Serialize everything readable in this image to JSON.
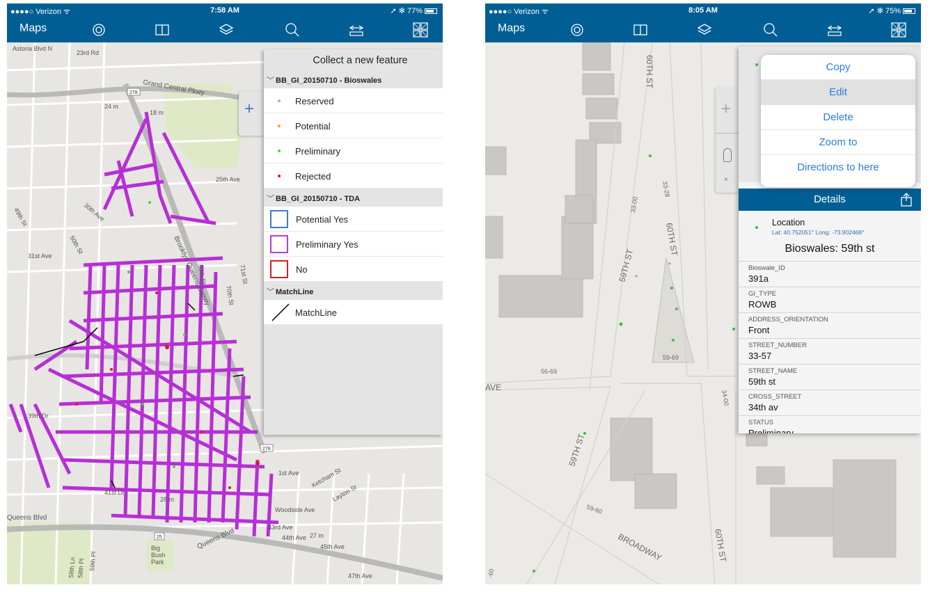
{
  "left": {
    "status": {
      "carrier": "●●●●○ Verizon ᯤ",
      "time": "7:58 AM",
      "battery": "➚ ✻ 77%"
    },
    "nav": {
      "maps": "Maps"
    },
    "map_labels": {
      "astoria": "Astoria Blvd N",
      "grand_central": "Grand Central Pkwy",
      "bqe": "Brooklyn Queens Expwy",
      "queens_blvd": "Queens Blvd",
      "queens_blvd_2": "Queens Blvd",
      "big_bush_park": "Big Bush Park",
      "park_labels": [
        "Big",
        "Bush",
        "Park"
      ],
      "st_41": "41st Dr",
      "st_39": "39th Dr",
      "st_43": "43rd Ave",
      "st_44": "44th Ave",
      "st_45": "45th Ave",
      "st_47": "47th Ave",
      "st_69": "69th St",
      "st_70": "70th St",
      "st_71": "71st St",
      "st_25": "25th Ave",
      "st_30": "30th Ave",
      "st_50": "50th St",
      "st_49": "49th St",
      "st_31": "31st Ave",
      "st_1": "1st Ave",
      "st_24": "24 m",
      "st_18": "18 m",
      "st_28": "28 m",
      "st_27": "27 m",
      "st_23": "23rd Rd",
      "woodside": "Woodside Ave",
      "route_278": "278",
      "route_25": "25",
      "route_278b": "278",
      "ketcham": "Ketcham St",
      "layton": "Layton St",
      "pl_59": "59th Pl",
      "ln_58": "58th Ln",
      "pl_58": "58th Pl"
    },
    "panel": {
      "title": "Collect a new feature",
      "groups": [
        {
          "name": "BB_GI_20150710 - Bioswales",
          "items": [
            {
              "label": "Reserved",
              "color": "#b0b0b0"
            },
            {
              "label": "Potential",
              "color": "#f5a623"
            },
            {
              "label": "Preliminary",
              "color": "#4cd137"
            },
            {
              "label": "Rejected",
              "color": "#e01a1a"
            }
          ]
        },
        {
          "name": "BB_GI_20150710 - TDA",
          "items": [
            {
              "label": "Potential Yes",
              "color": "#3a7bc8"
            },
            {
              "label": "Preliminary Yes",
              "color": "#b83bd6"
            },
            {
              "label": "No",
              "color": "#cc2222"
            }
          ]
        },
        {
          "name": "MatchLine",
          "items": [
            {
              "label": "MatchLine",
              "color": "#000000"
            }
          ]
        }
      ]
    }
  },
  "right": {
    "status": {
      "carrier": "●●●●○ Verizon ᯤ",
      "time": "8:05 AM",
      "battery": "➚ ✻ 75%"
    },
    "nav": {
      "maps": "Maps"
    },
    "map_labels": {
      "th60": "60TH ST",
      "th60b": "60TH ST",
      "th60c": "60TH ST",
      "th59": "59TH ST",
      "th59b": "59TH ST",
      "broadway": "BROADWAY",
      "ave": "AVE",
      "n3300": "33-00",
      "n3328": "33-28",
      "n5669": "56-69",
      "n5969": "59-69",
      "n3400": "34-00",
      "n5960": "59-60",
      "n60": "-60"
    },
    "popover": [
      "Copy",
      "Edit",
      "Delete",
      "Zoom to",
      "Directions to here"
    ],
    "details": {
      "header": "Details",
      "location_title": "Location",
      "location_coords": "Lat: 40.752051° Long: -73.902468°",
      "feature_title": "Bioswales: 59th st",
      "fields": [
        {
          "name": "Bioswale_ID",
          "value": "391a"
        },
        {
          "name": "GI_TYPE",
          "value": "ROWB"
        },
        {
          "name": "ADDRESS_ORIENTATION",
          "value": "Front"
        },
        {
          "name": "STREET_NUMBER",
          "value": "33-57"
        },
        {
          "name": "STREET_NAME",
          "value": "59th st"
        },
        {
          "name": "CROSS_STREET",
          "value": "34th av"
        },
        {
          "name": "STATUS",
          "value": "Preliminary"
        }
      ]
    }
  }
}
